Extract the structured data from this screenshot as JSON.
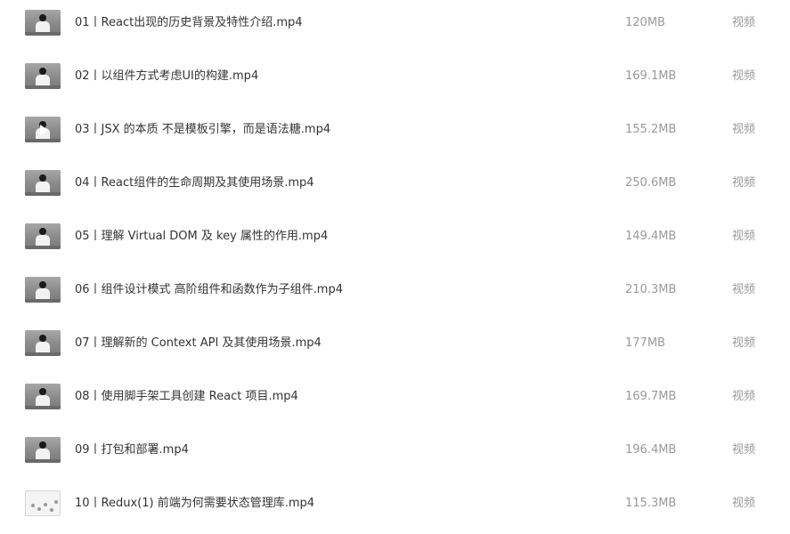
{
  "files": [
    {
      "name": "01丨React出现的历史背景及特性介绍.mp4",
      "size": "120MB",
      "type": "视频"
    },
    {
      "name": "02丨以组件方式考虑UI的构建.mp4",
      "size": "169.1MB",
      "type": "视频"
    },
    {
      "name": "03丨JSX 的本质  不是模板引擎，而是语法糖.mp4",
      "size": "155.2MB",
      "type": "视频"
    },
    {
      "name": "04丨React组件的生命周期及其使用场景.mp4",
      "size": "250.6MB",
      "type": "视频"
    },
    {
      "name": "05丨理解 Virtual DOM 及 key 属性的作用.mp4",
      "size": "149.4MB",
      "type": "视频"
    },
    {
      "name": "06丨组件设计模式  高阶组件和函数作为子组件.mp4",
      "size": "210.3MB",
      "type": "视频"
    },
    {
      "name": "07丨理解新的 Context API 及其使用场景.mp4",
      "size": "177MB",
      "type": "视频"
    },
    {
      "name": "08丨使用脚手架工具创建 React 项目.mp4",
      "size": "169.7MB",
      "type": "视频"
    },
    {
      "name": "09丨打包和部署.mp4",
      "size": "196.4MB",
      "type": "视频"
    },
    {
      "name": "10丨Redux(1)  前端为何需要状态管理库.mp4",
      "size": "115.3MB",
      "type": "视频"
    }
  ]
}
